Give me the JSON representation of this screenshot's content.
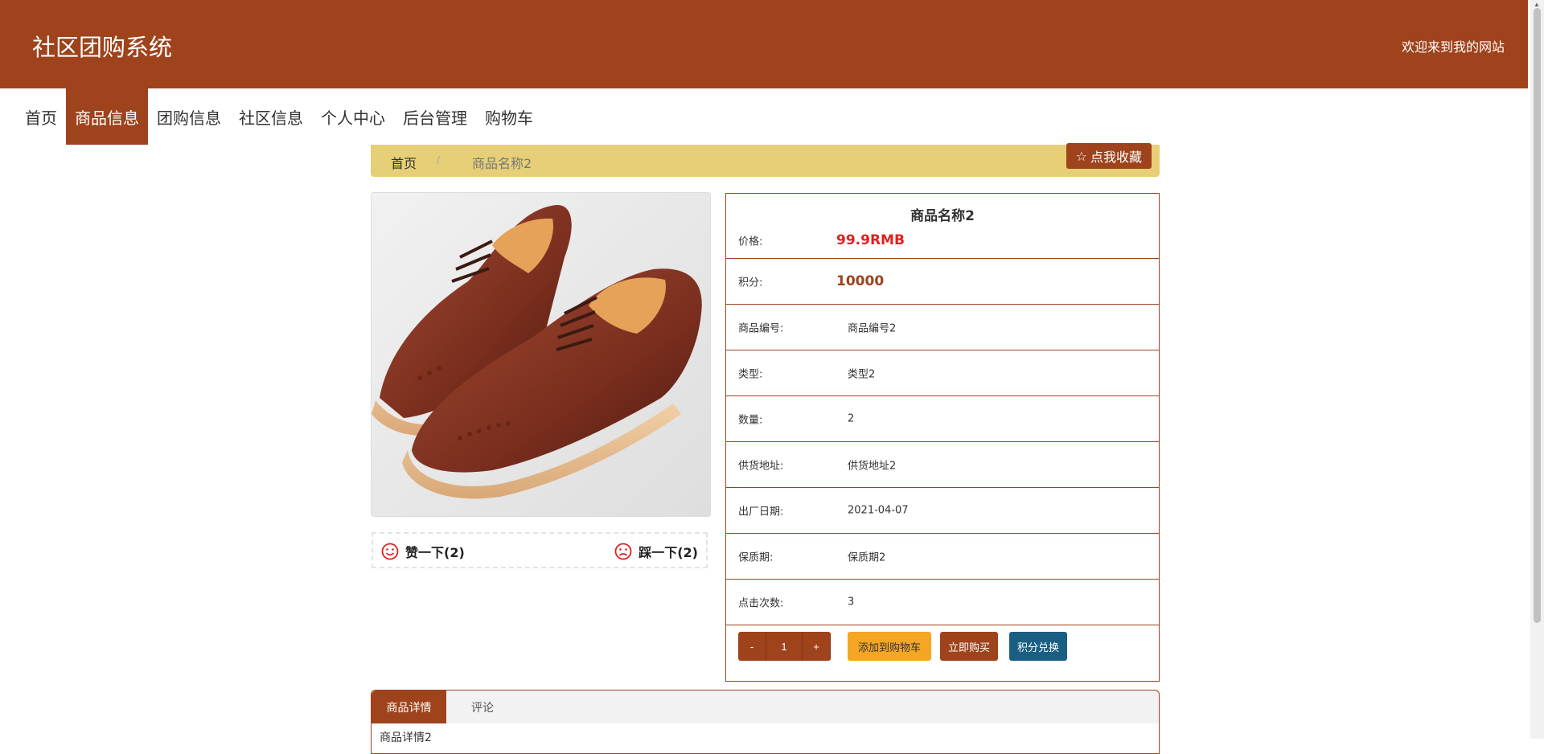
{
  "header": {
    "title": "社区团购系统",
    "welcome": "欢迎来到我的网站"
  },
  "nav": {
    "items": [
      "首页",
      "商品信息",
      "团购信息",
      "社区信息",
      "个人中心",
      "后台管理",
      "购物车"
    ],
    "active_index": 1
  },
  "breadcrumb": {
    "home": "首页",
    "separator": "/",
    "current": "商品名称2"
  },
  "favorite_button": {
    "label": "点我收藏",
    "icon": "star-outline-icon"
  },
  "votes": {
    "up": {
      "label": "赞一下(2)",
      "icon": "smile-icon"
    },
    "down": {
      "label": "踩一下(2)",
      "icon": "frown-icon"
    }
  },
  "product": {
    "name": "商品名称2",
    "price_label": "价格:",
    "price": "99.9RMB",
    "points_label": "积分:",
    "points": "10000",
    "fields": [
      {
        "label": "商品编号:",
        "value": "商品编号2"
      },
      {
        "label": "类型:",
        "value": "类型2"
      },
      {
        "label": "数量:",
        "value": "2"
      },
      {
        "label": "供货地址:",
        "value": "供货地址2"
      },
      {
        "label": "出厂日期:",
        "value": "2021-04-07"
      },
      {
        "label": "保质期:",
        "value": "保质期2"
      },
      {
        "label": "点击次数:",
        "value": "3"
      }
    ]
  },
  "cart": {
    "minus": "-",
    "quantity": "1",
    "plus": "+",
    "add_to_cart": "添加到购物车",
    "buy_now": "立即购买",
    "exchange": "积分兑换"
  },
  "tabs": {
    "items": [
      "商品详情",
      "评论"
    ],
    "content": "商品详情2"
  },
  "colors": {
    "primary": "#9e431c",
    "breadcrumb_bg": "#e6cf77",
    "price": "#e02020",
    "cart_button": "#f5a623",
    "exchange_button": "#1a5f83"
  }
}
